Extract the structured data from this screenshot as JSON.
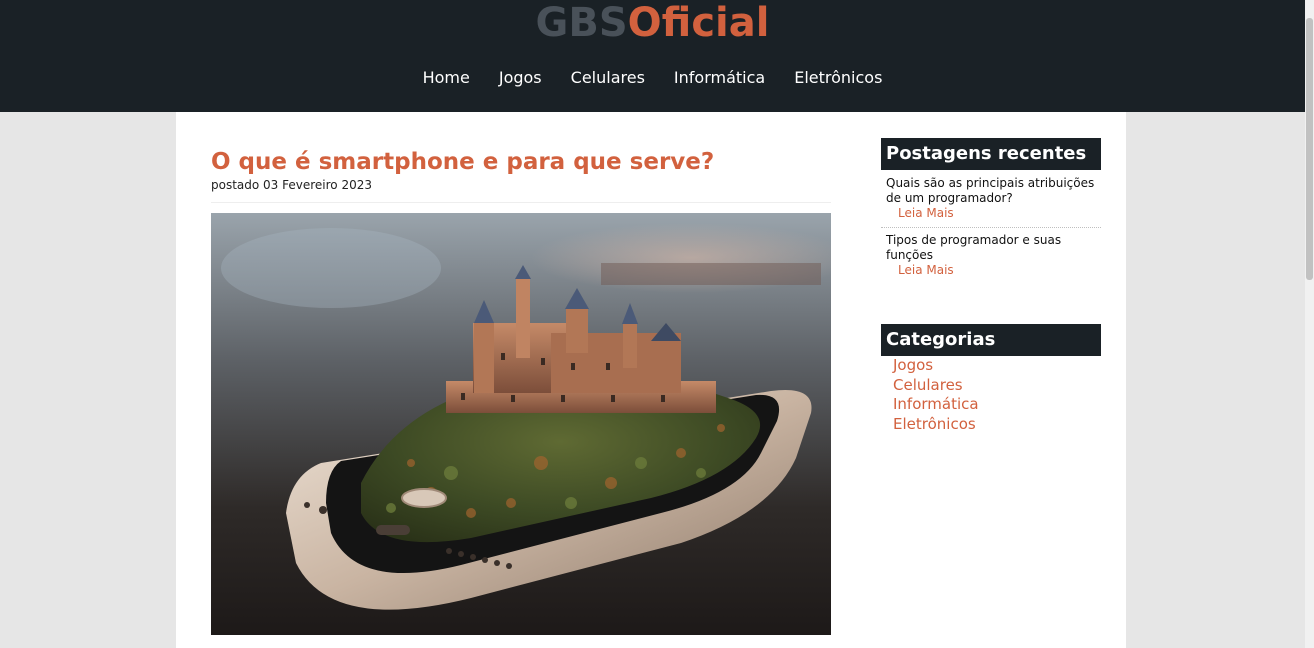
{
  "site": {
    "logo_part1": "GBS",
    "logo_part2": "Oficial",
    "nav": [
      "Home",
      "Jogos",
      "Celulares",
      "Informática",
      "Eletrônicos"
    ]
  },
  "post": {
    "title": "O que é smartphone e para que serve?",
    "date": "postado 03 Fevereiro 2023"
  },
  "sidebar": {
    "recent_title": "Postagens recentes",
    "recent_posts": [
      {
        "title": "Quais são as principais atribuições de um programador?",
        "read_more": "Leia Mais"
      },
      {
        "title": "Tipos de programador e suas funções",
        "read_more": "Leia Mais"
      }
    ],
    "categories_title": "Categorias",
    "categories": [
      "Jogos",
      "Celulares",
      "Informática",
      "Eletrônicos"
    ]
  },
  "colors": {
    "accent": "#d2613e",
    "header_bg": "#1a2126",
    "logo_gray": "#495159",
    "page_bg": "#e6e6e6"
  }
}
